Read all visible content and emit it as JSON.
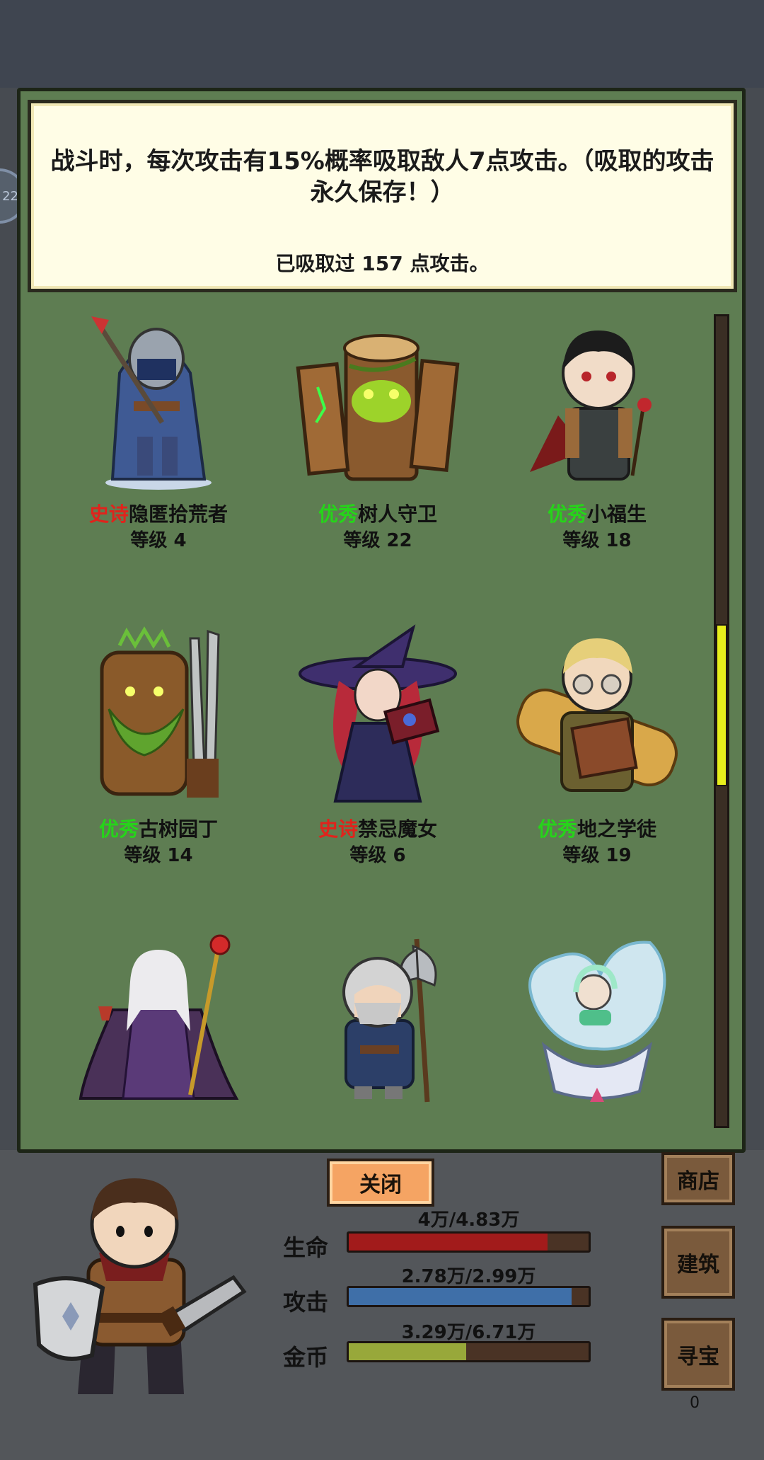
{
  "indicator": {
    "text": "22"
  },
  "description": {
    "text": "战斗时，每次攻击有15%概率吸取敌人7点攻击。（吸取的攻击永久保存！）",
    "absorbed": "已吸取过 157 点攻击。"
  },
  "characters": [
    {
      "rarity": "史诗",
      "rarity_type": "epic",
      "name": "隐匿拾荒者",
      "level": "等级 4"
    },
    {
      "rarity": "优秀",
      "rarity_type": "good",
      "name": "树人守卫",
      "level": "等级 22"
    },
    {
      "rarity": "优秀",
      "rarity_type": "good",
      "name": "小福生",
      "level": "等级 18"
    },
    {
      "rarity": "优秀",
      "rarity_type": "good",
      "name": "古树园丁",
      "level": "等级 14"
    },
    {
      "rarity": "史诗",
      "rarity_type": "epic",
      "name": "禁忌魔女",
      "level": "等级 6"
    },
    {
      "rarity": "优秀",
      "rarity_type": "good",
      "name": "地之学徒",
      "level": "等级 19"
    },
    {
      "rarity": "",
      "rarity_type": "",
      "name": "",
      "level": ""
    },
    {
      "rarity": "",
      "rarity_type": "",
      "name": "",
      "level": ""
    },
    {
      "rarity": "",
      "rarity_type": "",
      "name": "",
      "level": ""
    }
  ],
  "scroll": {
    "position": 0.38,
    "visible_fraction": 0.2
  },
  "buttons": {
    "close": "关闭",
    "shop": "商店",
    "build": "建筑",
    "treasure": "寻宝",
    "treasure_count": "0"
  },
  "stats": {
    "hp": {
      "label": "生命",
      "value": "4万/4.83万",
      "fraction": 0.83,
      "color": "#a21b1b"
    },
    "attack": {
      "label": "攻击",
      "value": "2.78万/2.99万",
      "fraction": 0.93,
      "color": "#3f6fa8"
    },
    "gold": {
      "label": "金币",
      "value": "3.29万/6.71万",
      "fraction": 0.49,
      "color": "#98a83a"
    }
  },
  "colors": {
    "epic": "#e0231c",
    "good": "#26d41a"
  }
}
